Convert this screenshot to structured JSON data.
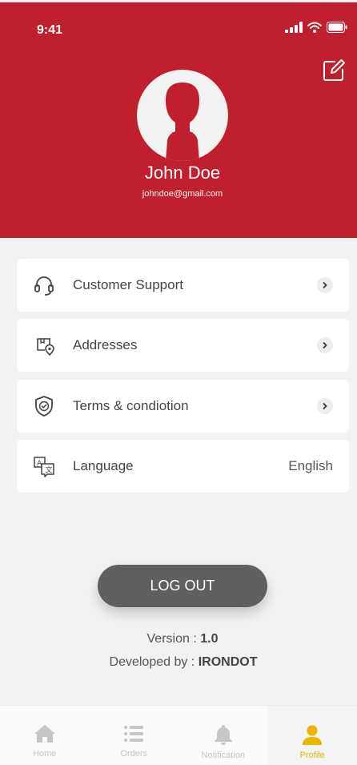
{
  "status_bar": {
    "time": "9:41"
  },
  "profile": {
    "name": "John Doe",
    "email": "johndoe@gmail.com"
  },
  "menu": [
    {
      "label": "Customer Support",
      "icon": "headset-icon"
    },
    {
      "label": "Addresses",
      "icon": "map-pin-icon"
    },
    {
      "label": "Terms & condiotion",
      "icon": "shield-check-icon"
    },
    {
      "label": "Language",
      "icon": "translate-icon",
      "value": "English"
    }
  ],
  "logout_label": "LOG OUT",
  "footer": {
    "version_label": "Version : ",
    "version_value": "1.0",
    "developed_label": "Developed by : ",
    "developer": "IRONDOT"
  },
  "nav": [
    {
      "label": "Home",
      "icon": "home-icon"
    },
    {
      "label": "Orders",
      "icon": "list-icon"
    },
    {
      "label": "Notification",
      "icon": "bell-icon"
    },
    {
      "label": "Profile",
      "icon": "user-icon",
      "active": true
    }
  ],
  "colors": {
    "header": "#c0202d",
    "logout": "#5f5f5f",
    "active_tab": "#e9b600",
    "inactive_tab": "#c6c6c6"
  }
}
